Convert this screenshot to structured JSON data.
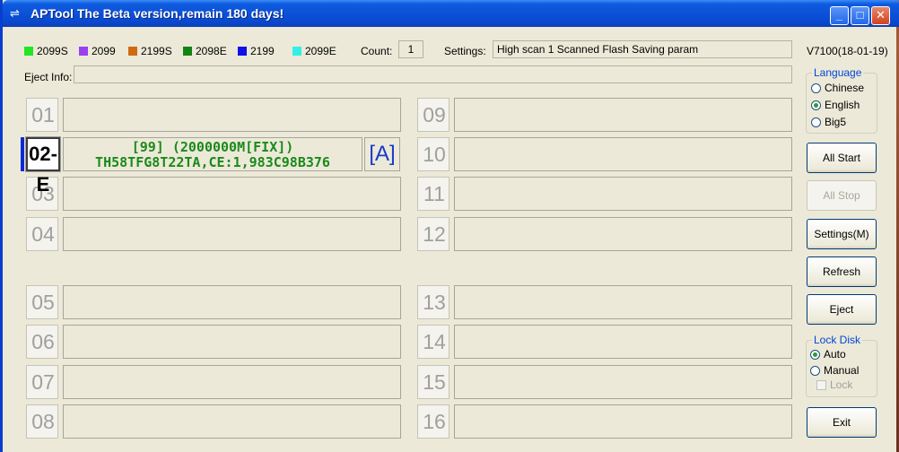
{
  "window": {
    "title": "APTool  The Beta version,remain 180 days!"
  },
  "legend": [
    {
      "label": "2099S",
      "color": "#22e622"
    },
    {
      "label": "2099",
      "color": "#9a40f0"
    },
    {
      "label": "2199S",
      "color": "#d06a10"
    },
    {
      "label": "2098E",
      "color": "#128412"
    },
    {
      "label": "2199",
      "color": "#1010e8"
    },
    {
      "label": "2099E",
      "color": "#30f0e8"
    }
  ],
  "count": {
    "label": "Count:",
    "value": "1"
  },
  "settings": {
    "label": "Settings:",
    "value": "High scan 1 Scanned Flash Saving param"
  },
  "version": "V7100(18-01-19)",
  "eject_info": {
    "label": "Eject Info:",
    "value": ""
  },
  "slots_left": [
    "01",
    "02-E",
    "03",
    "04",
    "05",
    "06",
    "07",
    "08"
  ],
  "slots_right": [
    "09",
    "10",
    "11",
    "12",
    "13",
    "14",
    "15",
    "16"
  ],
  "active_slot": {
    "number": "02-E",
    "line1": "[99]  (2000000M[FIX])",
    "line2": "TH58TFG8T22TA,CE:1,983C98B376",
    "drive": "[A]"
  },
  "language": {
    "title": "Language",
    "options": [
      {
        "label": "Chinese",
        "selected": false
      },
      {
        "label": "English",
        "selected": true
      },
      {
        "label": "Big5",
        "selected": false
      }
    ]
  },
  "buttons": {
    "all_start": "All Start",
    "all_stop": "All Stop",
    "settings": "Settings(M)",
    "refresh": "Refresh",
    "eject": "Eject",
    "exit": "Exit"
  },
  "lock_disk": {
    "title": "Lock Disk",
    "options": [
      {
        "label": "Auto",
        "selected": true
      },
      {
        "label": "Manual",
        "selected": false
      }
    ],
    "lock_label": "Lock"
  }
}
